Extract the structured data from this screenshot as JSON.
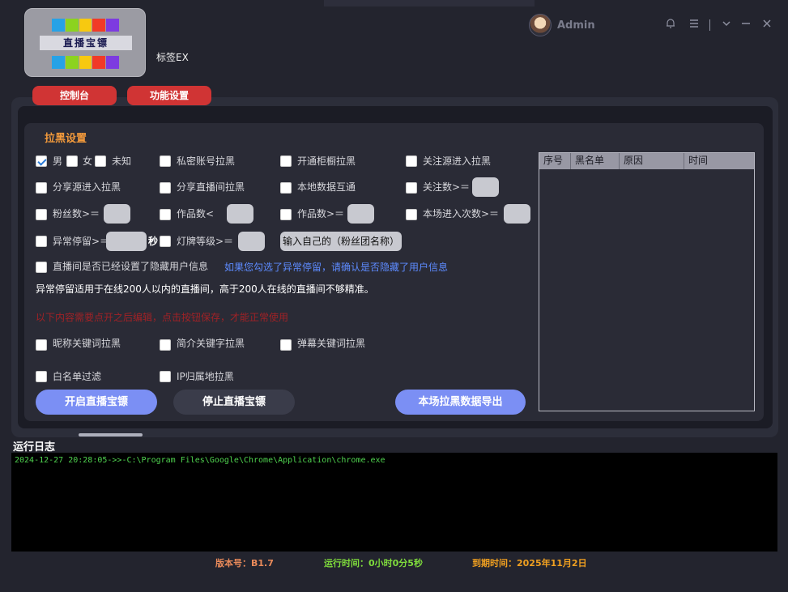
{
  "app": {
    "logo_text": "直播宝镖",
    "title": "标签EX",
    "username": "Admin"
  },
  "colors": {
    "logo_bars": [
      "#27a2e6",
      "#8cd31f",
      "#f7c910",
      "#f13a27",
      "#7d3be0"
    ]
  },
  "window_icons": [
    "bell-icon",
    "menu-icon",
    "divider",
    "chevron-down-icon",
    "minimize-icon",
    "close-icon"
  ],
  "tabs": [
    {
      "label": "控制台"
    },
    {
      "label": "功能设置"
    }
  ],
  "section": {
    "title": "拉黑设置"
  },
  "options": {
    "male": "男",
    "female": "女",
    "unknown": "未知",
    "private_account": "私密账号拉黑",
    "open_showcase": "开通柜橱拉黑",
    "follow_source": "关注源进入拉黑",
    "share_source": "分享源进入拉黑",
    "share_room": "分享直播间拉黑",
    "local_data": "本地数据互通",
    "follow_count": "关注数>＝",
    "fans_count": "粉丝数>＝",
    "works_less": "作品数<",
    "works_more": "作品数>＝",
    "enter_times": "本场进入次数>＝",
    "abnormal_stay": "异常停留>＝",
    "seconds_unit": "秒",
    "badge_level": "灯牌等级>＝",
    "fan_club_btn": "输入自己的（粉丝团名称）",
    "hidden_info": "直播间是否已经设置了隐藏用户信息",
    "nickname_kw": "昵称关键词拉黑",
    "intro_kw": "简介关键字拉黑",
    "danmaku_kw": "弹幕关键词拉黑",
    "whitelist": "白名单过滤",
    "ip_location": "IP归属地拉黑"
  },
  "notes": {
    "blue": "如果您勾选了异常停留，请确认是否隐藏了用户信息",
    "white": "异常停留适用于在线200人以内的直播间，高于200人在线的直播间不够精准。",
    "red": "以下内容需要点开之后编辑，点击按钮保存，才能正常使用"
  },
  "table": {
    "columns": [
      "序号",
      "黑名单",
      "原因",
      "时间"
    ],
    "rows": []
  },
  "buttons": {
    "start": "开启直播宝镖",
    "stop": "停止直播宝镖",
    "export": "本场拉黑数据导出"
  },
  "log": {
    "title": "运行日志",
    "lines": [
      "2024-12-27 20:28:05->>-C:\\Program Files\\Google\\Chrome\\Application\\chrome.exe"
    ]
  },
  "status": {
    "version": "版本号：B1.7",
    "runtime": "运行时间：0小时0分5秒",
    "expiry": "到期时间：2025年11月2日"
  },
  "status_colors": {
    "version": "#e98a5a",
    "runtime": "#7fdc3c",
    "expiry": "#f0a020"
  }
}
